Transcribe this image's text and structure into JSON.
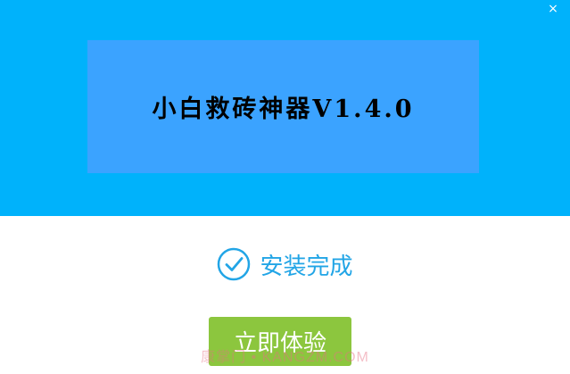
{
  "window": {
    "close_glyph": "×"
  },
  "banner": {
    "title": "小白救砖神器V1.4.0"
  },
  "status": {
    "icon": "checkmark-circle-icon",
    "text": "安装完成",
    "color": "#22a5e6"
  },
  "action": {
    "button_label": "立即体验",
    "button_color": "#8cc63e"
  },
  "watermark": {
    "text": "康掌门 • KANGZM.COM"
  },
  "colors": {
    "header_bg": "#00b2fb",
    "banner_bg": "#3ba3ff"
  }
}
